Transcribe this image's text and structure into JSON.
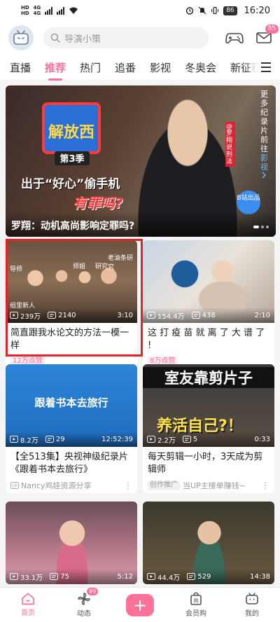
{
  "status_bar": {
    "sim1": "HD",
    "sim2": "HD",
    "network1": "4G",
    "network2": "4G",
    "battery": "86",
    "time": "16:20"
  },
  "header": {
    "search_placeholder": "导演小策",
    "mail_badge": "85"
  },
  "tabs": [
    {
      "label": "直播"
    },
    {
      "label": "推荐"
    },
    {
      "label": "热门"
    },
    {
      "label": "追番"
    },
    {
      "label": "影视"
    },
    {
      "label": "冬奥会"
    },
    {
      "label": "新征程"
    }
  ],
  "banner": {
    "caption": "罗翔：动机高尚影响定罪吗?",
    "side_text_1": "更多纪录片前往",
    "side_text_2": "影视",
    "show_title": "解放西",
    "season": "第3季",
    "slogan_1": "出于“好心”偷手机",
    "slogan_2": "有罪吗?",
    "speaker_tag": "@罗翔说刑法",
    "badge": "B站出品"
  },
  "cards": [
    {
      "title": "简直跟我水论文的方法一模一样",
      "views": "239万",
      "comments": "2140",
      "duration": "3:10",
      "tag": "12万点赞",
      "thumb_labels": [
        "导师",
        "师姐",
        "研究",
        "老油条研究",
        "组里新人"
      ]
    },
    {
      "title": "这 打 疫 苗 就 离 了 大 谱 了 !",
      "views": "154.4万",
      "comments": "438",
      "duration": "2:10",
      "tag": "8万点赞"
    },
    {
      "title": "【全513集】央视神级纪录片《跟着书本去旅行》",
      "views": "8.2万",
      "comments": "29",
      "duration": "12:52:39",
      "author": "Nancy鸡娃资源分享",
      "thumb_text": "跟着书本去旅行"
    },
    {
      "title": "每天剪辑一小时，3天成为剪辑师",
      "views": "2.2万",
      "comments": "5",
      "duration": "0:33",
      "tag": "创作推广",
      "author": "当UP主接单赚钱~",
      "thumb_text_1": "室友靠剪片子",
      "thumb_text_2": "养活自己?！"
    },
    {
      "views": "33.1万",
      "comments": "75",
      "duration": "5:12"
    },
    {
      "views": "44.4万",
      "comments": "529",
      "duration": "14:38"
    }
  ],
  "bottom_nav": [
    {
      "label": "首页"
    },
    {
      "label": "动态",
      "badge": "99"
    },
    {
      "label": "+"
    },
    {
      "label": "会员购"
    },
    {
      "label": "我的"
    }
  ],
  "colors": {
    "accent": "#fb7299",
    "highlight_box": "#e3222a"
  }
}
